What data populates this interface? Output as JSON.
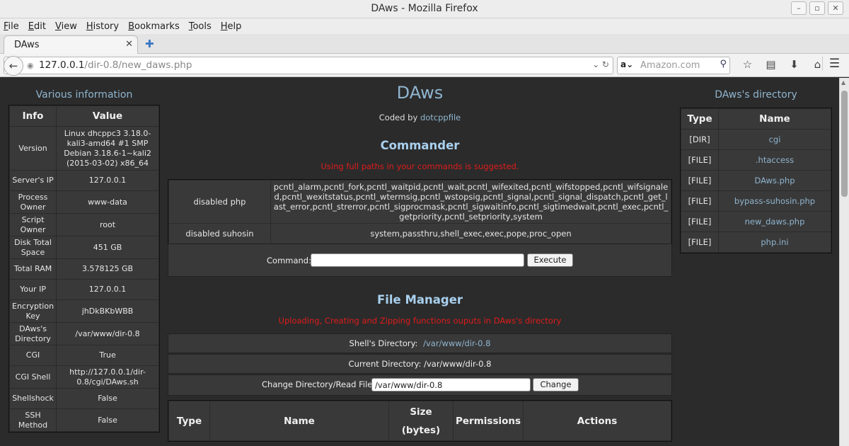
{
  "window": {
    "title": "DAws - Mozilla Firefox"
  },
  "menu": [
    "File",
    "Edit",
    "View",
    "History",
    "Bookmarks",
    "Tools",
    "Help"
  ],
  "tab": {
    "label": "DAws"
  },
  "url": {
    "host": "127.0.0.1",
    "path": "/dir-0.8/new_daws.php"
  },
  "search": {
    "placeholder": "Amazon.com"
  },
  "left": {
    "title": "Various information",
    "headers": [
      "Info",
      "Value"
    ],
    "rows": [
      [
        "Version",
        "Linux dhcppc3 3.18.0-kali3-amd64 #1 SMP Debian 3.18.6-1~kali2 (2015-03-02) x86_64"
      ],
      [
        "Server's IP",
        "127.0.0.1"
      ],
      [
        "Process Owner",
        "www-data"
      ],
      [
        "Script Owner",
        "root"
      ],
      [
        "Disk Total Space",
        "451 GB"
      ],
      [
        "Total RAM",
        "3.578125 GB"
      ],
      [
        "Your IP",
        "127.0.0.1"
      ],
      [
        "Encryption Key",
        "jhDkBKbWBB"
      ],
      [
        "DAws's Directory",
        "/var/www/dir-0.8"
      ],
      [
        "CGI",
        "True"
      ],
      [
        "CGI Shell",
        "http://127.0.0.1/dir-0.8/cgi/DAws.sh"
      ],
      [
        "Shellshock",
        "False"
      ],
      [
        "SSH Method",
        "False"
      ]
    ]
  },
  "center": {
    "brand": "DAws",
    "coded_by": "Coded by",
    "author": "dotcppfile",
    "commander": {
      "title": "Commander",
      "warning": "Using full paths in your commands is suggested.",
      "disabled_php_label": "disabled php",
      "disabled_php": "pcntl_alarm,pcntl_fork,pcntl_waitpid,pcntl_wait,pcntl_wifexited,pcntl_wifstopped,pcntl_wifsignaled,pcntl_wexitstatus,pcntl_wtermsig,pcntl_wstopsig,pcntl_signal,pcntl_signal_dispatch,pcntl_get_last_error,pcntl_strerror,pcntl_sigprocmask,pcntl_sigwaitinfo,pcntl_sigtimedwait,pcntl_exec,pcntl_getpriority,pcntl_setpriority,system",
      "disabled_suhosin_label": "disabled suhosin",
      "disabled_suhosin": "system,passthru,shell_exec,exec,pope,proc_open",
      "command_label": "Command:",
      "command_value": "",
      "execute_label": "Execute"
    },
    "file_manager": {
      "title": "File Manager",
      "warning": "Uploading, Creating and Zipping functions ouputs in DAws's directory",
      "shell_dir_label": "Shell's Directory:",
      "shell_dir": "/var/www/dir-0.8",
      "current_dir_label": "Current Directory:",
      "current_dir": "/var/www/dir-0.8",
      "change_dir_label": "Change Directory/Read File:",
      "change_dir_value": "/var/www/dir-0.8",
      "change_label": "Change",
      "headers": [
        "Type",
        "Name",
        "Size (bytes)",
        "Permissions",
        "Actions"
      ]
    }
  },
  "right": {
    "title": "DAws's directory",
    "headers": [
      "Type",
      "Name"
    ],
    "rows": [
      [
        "[DIR]",
        "cgi"
      ],
      [
        "[FILE]",
        ".htaccess"
      ],
      [
        "[FILE]",
        "DAws.php"
      ],
      [
        "[FILE]",
        "bypass-suhosin.php"
      ],
      [
        "[FILE]",
        "new_daws.php"
      ],
      [
        "[FILE]",
        "php.ini"
      ]
    ]
  }
}
